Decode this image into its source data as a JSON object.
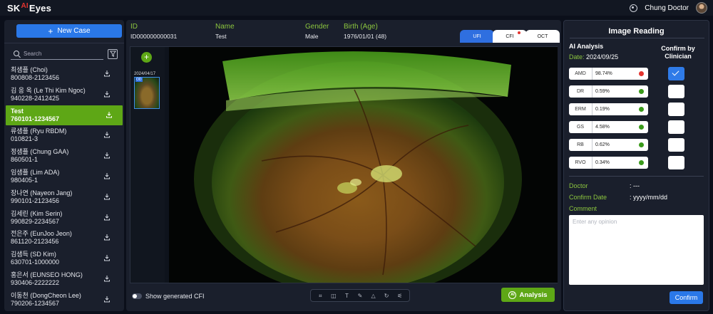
{
  "app": {
    "logo_main": "SK",
    "logo_ai": "AI",
    "logo_tail": "Eyes",
    "user": "Chung Doctor"
  },
  "sidebar": {
    "new_case_label": "New Case",
    "search_placeholder": "Search",
    "patients": [
      {
        "name": "최샘플 (Choi)",
        "id": "800808-2123456",
        "selected": false
      },
      {
        "name": "김 응 옥 (Le Thi Kim Ngoc)",
        "id": "940228-2412425",
        "selected": false
      },
      {
        "name": "Test",
        "id": "760101-1234567",
        "selected": true
      },
      {
        "name": "류샘플 (Ryu RBDM)",
        "id": "010821-3",
        "selected": false
      },
      {
        "name": "정샘플 (Chung GAA)",
        "id": "860501-1",
        "selected": false
      },
      {
        "name": "임샘플 (Lim ADA)",
        "id": "980405-1",
        "selected": false
      },
      {
        "name": "장나연 (Nayeon Jang)",
        "id": "990101-2123456",
        "selected": false
      },
      {
        "name": "김세린 (Kim Serin)",
        "id": "990829-2234567",
        "selected": false
      },
      {
        "name": "전은주 (EunJoo Jeon)",
        "id": "861120-2123456",
        "selected": false
      },
      {
        "name": "김샘득 (SD Kim)",
        "id": "630701-1000000",
        "selected": false
      },
      {
        "name": "홍은서 (EUNSEO HONG)",
        "id": "930406-2222222",
        "selected": false
      },
      {
        "name": "이동천 (DongCheon Lee)",
        "id": "790206-1234567",
        "selected": false
      }
    ]
  },
  "patient_info": {
    "id_label": "ID",
    "id_value": "ID000000000031",
    "name_label": "Name",
    "name_value": "Test",
    "gender_label": "Gender",
    "gender_value": "Male",
    "birth_label": "Birth (Age)",
    "birth_value": "1976/01/01 (48)"
  },
  "tabs": [
    {
      "label": "UFI",
      "active": true,
      "alert": false
    },
    {
      "label": "CFI",
      "active": false,
      "alert": true
    },
    {
      "label": "OCT",
      "active": false,
      "alert": false
    }
  ],
  "viewer": {
    "thumb_date": "2024/04/17",
    "thumb_eye": "OD",
    "show_cfi_label": "Show generated CFI",
    "analysis_label": "Analysis",
    "ai_badge": "AI",
    "tools": [
      "crop-icon",
      "compare-icon",
      "text-icon",
      "pen-icon",
      "shapes-icon",
      "rotate-icon",
      "adjust-icon"
    ]
  },
  "reading": {
    "title": "Image Reading",
    "ai_analysis_label": "AI Analysis",
    "date_label": "Date:",
    "date_value": "2024/09/25",
    "confirm_header": "Confirm by Clinician",
    "scores": [
      {
        "code": "AMD",
        "pct": "98.74%",
        "status": "red",
        "confirmed": true
      },
      {
        "code": "DR",
        "pct": "0.59%",
        "status": "green",
        "confirmed": false
      },
      {
        "code": "ERM",
        "pct": "0.19%",
        "status": "green",
        "confirmed": false
      },
      {
        "code": "GS",
        "pct": "4.58%",
        "status": "green",
        "confirmed": false
      },
      {
        "code": "RB",
        "pct": "0.62%",
        "status": "green",
        "confirmed": false
      },
      {
        "code": "RVO",
        "pct": "0.34%",
        "status": "green",
        "confirmed": false
      }
    ],
    "doctor_label": "Doctor",
    "doctor_value": ": ---",
    "confirm_date_label": "Confirm Date",
    "confirm_date_value": ": yyyy/mm/dd",
    "comment_label": "Comment",
    "comment_placeholder": "Enter any opinion",
    "confirm_btn": "Confirm"
  },
  "colors": {
    "accent_green": "#5ea716",
    "label_green": "#8cc63f",
    "primary_blue": "#2a78e8",
    "status_red": "#e3342f",
    "status_green": "#3a9a1a"
  }
}
